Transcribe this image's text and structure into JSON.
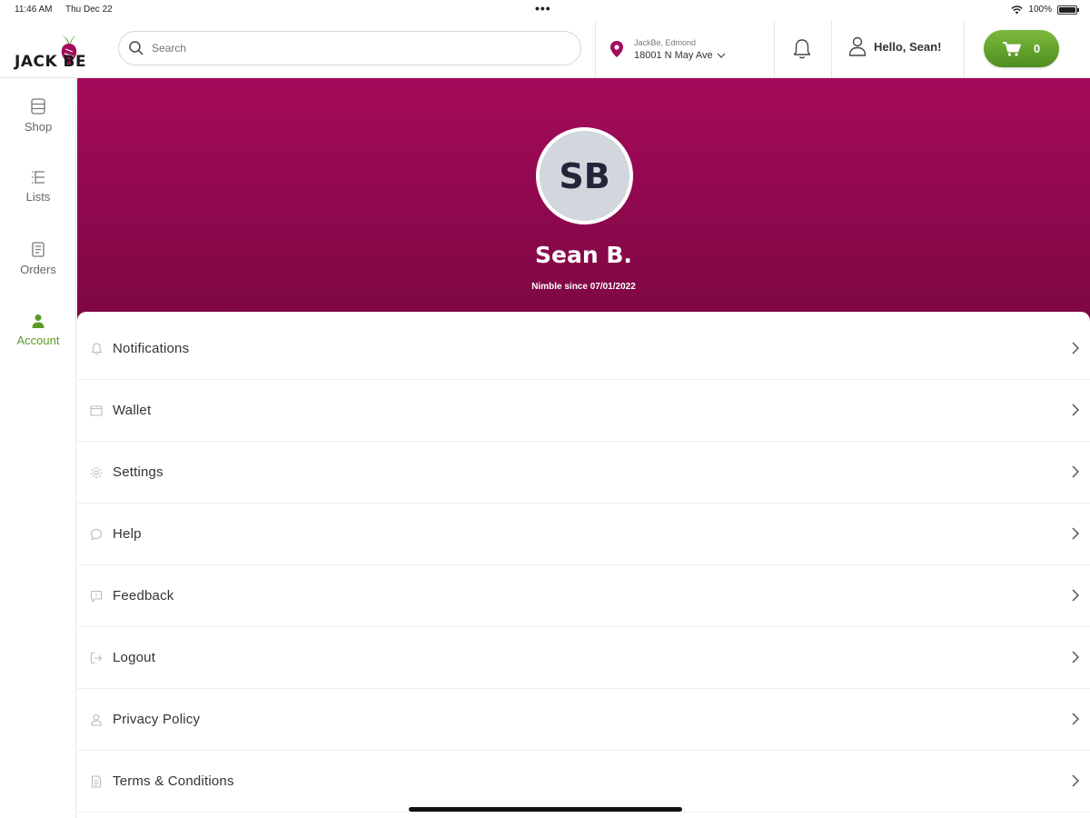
{
  "status_bar": {
    "time": "11:46 AM",
    "date": "Thu Dec 22",
    "dots": "•••",
    "battery": "100%"
  },
  "header": {
    "logo_text": "JACK BE",
    "search_placeholder": "Search",
    "store_name": "JackBe, Edmond",
    "store_address": "18001 N May Ave",
    "greeting": "Hello, Sean!",
    "cart_count": "0"
  },
  "sidebar": {
    "items": [
      {
        "label": "Shop",
        "icon": "shop-icon",
        "active": false
      },
      {
        "label": "Lists",
        "icon": "list-icon",
        "active": false
      },
      {
        "label": "Orders",
        "icon": "orders-icon",
        "active": false
      },
      {
        "label": "Account",
        "icon": "account-icon",
        "active": true
      }
    ]
  },
  "profile": {
    "initials": "SB",
    "name": "Sean B.",
    "since": "Nimble since 07/01/2022"
  },
  "menu": {
    "items": [
      {
        "label": "Notifications",
        "icon": "bell-icon"
      },
      {
        "label": "Wallet",
        "icon": "wallet-icon"
      },
      {
        "label": "Settings",
        "icon": "gear-icon"
      },
      {
        "label": "Help",
        "icon": "help-chat-icon"
      },
      {
        "label": "Feedback",
        "icon": "feedback-icon"
      },
      {
        "label": "Logout",
        "icon": "logout-icon"
      },
      {
        "label": "Privacy Policy",
        "icon": "privacy-icon"
      },
      {
        "label": "Terms & Conditions",
        "icon": "document-icon"
      }
    ]
  },
  "colors": {
    "brand_magenta": "#a50a5a",
    "accent_green": "#5a9b28"
  }
}
